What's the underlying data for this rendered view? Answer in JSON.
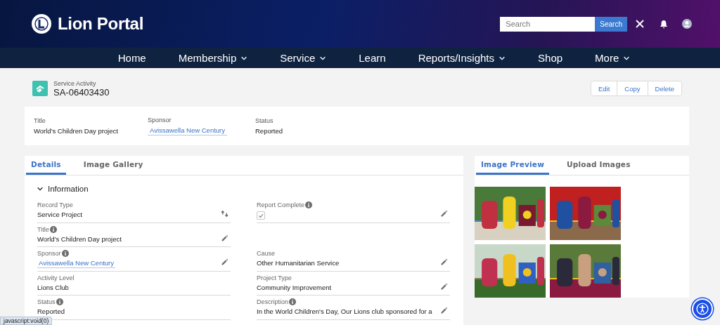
{
  "header": {
    "brand": "Lion Portal",
    "search": {
      "placeholder": "Search",
      "button": "Search"
    }
  },
  "nav": [
    {
      "label": "Home",
      "has_menu": false
    },
    {
      "label": "Membership",
      "has_menu": true
    },
    {
      "label": "Service",
      "has_menu": true
    },
    {
      "label": "Learn",
      "has_menu": false
    },
    {
      "label": "Reports/Insights",
      "has_menu": true
    },
    {
      "label": "Shop",
      "has_menu": false
    },
    {
      "label": "More",
      "has_menu": true
    }
  ],
  "record": {
    "object": "Service Activity",
    "name": "SA-06403430",
    "actions": [
      "Edit",
      "Copy",
      "Delete"
    ]
  },
  "highlights": [
    {
      "label": "Title",
      "value": "World's Children Day project",
      "kind": "text"
    },
    {
      "label": "Sponsor",
      "value": "Avissawella New Century",
      "kind": "link"
    },
    {
      "label": "Status",
      "value": "Reported",
      "kind": "text"
    }
  ],
  "details": {
    "tabs": [
      {
        "label": "Details",
        "selected": true
      },
      {
        "label": "Image Gallery",
        "selected": false
      }
    ],
    "section": {
      "title": "Information",
      "expanded": true
    },
    "rows": [
      {
        "left": {
          "label": "Record Type",
          "info": false,
          "kind": "record_type",
          "value": "Service Project",
          "editable": true
        },
        "right": {
          "label": "Report Complete",
          "info": true,
          "kind": "checkbox",
          "checked": true,
          "editable": true
        }
      },
      {
        "left": {
          "label": "Title",
          "info": true,
          "kind": "text",
          "value": "World's Children Day project",
          "editable": true
        }
      },
      {
        "left": {
          "label": "Sponsor",
          "info": true,
          "kind": "link",
          "value": "Avissawella New Century",
          "editable": true
        },
        "right": {
          "label": "Cause",
          "info": false,
          "kind": "text",
          "value": "Other Humanitarian Service",
          "editable": true
        }
      },
      {
        "left": {
          "label": "Activity Level",
          "info": false,
          "kind": "text",
          "value": "Lions Club",
          "editable": false
        },
        "right": {
          "label": "Project Type",
          "info": false,
          "kind": "text",
          "value": "Community Improvement",
          "editable": true
        }
      },
      {
        "left": {
          "label": "Status",
          "info": true,
          "kind": "text",
          "value": "Reported",
          "editable": false
        },
        "right": {
          "label": "Description",
          "info": true,
          "kind": "text",
          "value": "In the World Children's Day, Our Lions club sponsored for a",
          "editable": true
        }
      }
    ]
  },
  "preview": {
    "tabs": [
      {
        "label": "Image Preview",
        "selected": true
      },
      {
        "label": "Upload Images",
        "selected": false
      }
    ]
  },
  "status_bar": "javascript:void(0)"
}
